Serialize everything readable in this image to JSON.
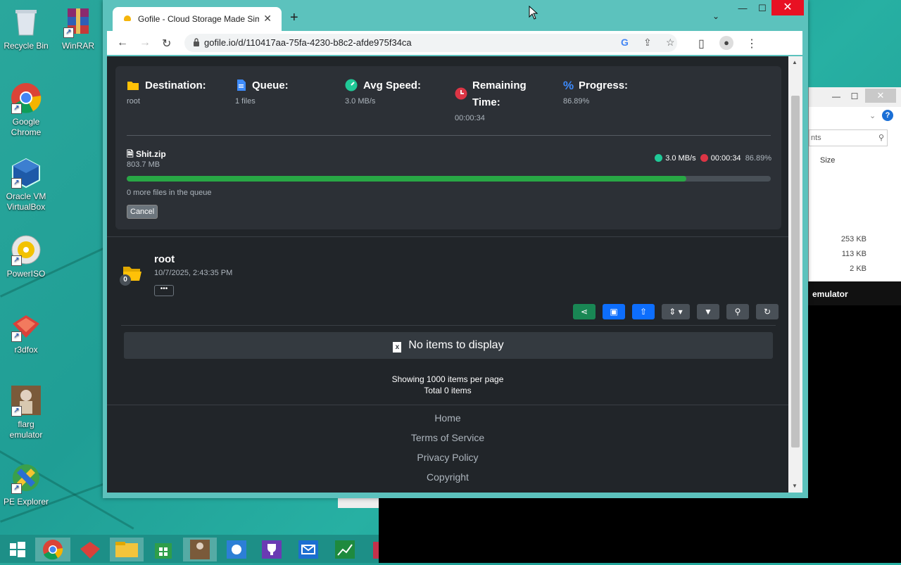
{
  "desktop": {
    "icons": [
      {
        "label": "Recycle Bin",
        "icon": "recycle-bin-icon"
      },
      {
        "label": "WinRAR",
        "icon": "winrar-icon"
      },
      {
        "label": "Google Chrome",
        "icon": "chrome-icon"
      },
      {
        "label": "Oracle VM VirtualBox",
        "icon": "virtualbox-icon"
      },
      {
        "label": "PowerISO",
        "icon": "poweriso-icon"
      },
      {
        "label": "r3dfox",
        "icon": "r3dfox-icon"
      },
      {
        "label": "flarg emulator",
        "icon": "flarg-icon"
      },
      {
        "label": "PE Explorer",
        "icon": "pe-explorer-icon"
      }
    ],
    "background_color": "#2aa79c"
  },
  "explorer": {
    "search_placeholder": "nts",
    "size_header": "Size",
    "sizes": [
      "253 KB",
      "113 KB",
      "2 KB"
    ],
    "emulator_label": "emulator"
  },
  "browser": {
    "tab_title": "Gofile - Cloud Storage Made Simple",
    "url": "gofile.io/d/110417aa-75fa-4230-b8c2-afde975f34ca"
  },
  "upload": {
    "destination": {
      "label": "Destination:",
      "value": "root"
    },
    "queue": {
      "label": "Queue:",
      "value": "1 files"
    },
    "avg_speed": {
      "label": "Avg Speed:",
      "value": "3.0 MB/s"
    },
    "remaining": {
      "label_1": "Remaining",
      "label_2": "Time:",
      "value": "00:00:34"
    },
    "progress": {
      "label": "Progress:",
      "value": "86.89%"
    },
    "file": {
      "name": "Shit.zip",
      "size": "803.7 MB",
      "speed": "3.0 MB/s",
      "time": "00:00:34",
      "percent": "86.89%",
      "fraction": 0.8689
    },
    "queue_text": "0 more files in the queue",
    "cancel_label": "Cancel"
  },
  "folder": {
    "name": "root",
    "date": "10/7/2025, 2:43:35 PM",
    "badge": "0",
    "more_label": "•••",
    "empty_text": "No items to display",
    "per_page": "Showing 1000 items per page",
    "total": "Total 0 items"
  },
  "footer": {
    "links": [
      "Home",
      "Terms of Service",
      "Privacy Policy",
      "Copyright"
    ]
  },
  "colors": {
    "page_bg": "#212529",
    "panel_bg": "#2c3036",
    "progress_green": "#28a745",
    "accent_blue": "#0d6efd",
    "red": "#dc3545",
    "yellow": "#ffc107"
  }
}
